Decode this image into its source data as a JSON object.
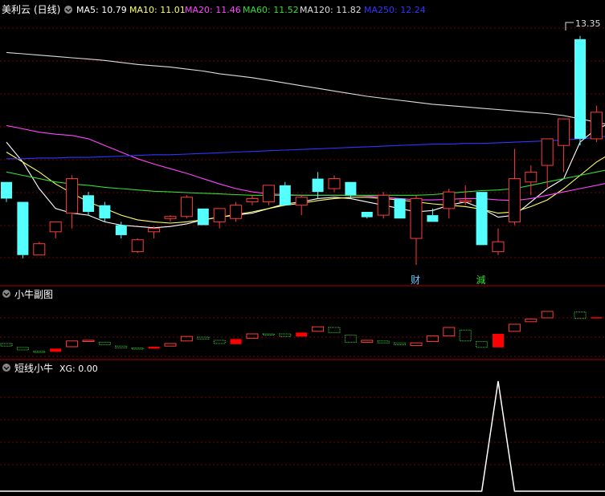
{
  "main_panel": {
    "stock_name": "美利云",
    "period": "(日线)",
    "ma_legend": [
      {
        "label": "MA5: 10.79",
        "color": "#ffffff"
      },
      {
        "label": "MA10: 11.01",
        "color": "#ffff66"
      },
      {
        "label": "MA20: 11.46",
        "color": "#ff44ff"
      },
      {
        "label": "MA60: 11.52",
        "color": "#33dd33"
      },
      {
        "label": "MA120: 11.82",
        "color": "#dddddd"
      },
      {
        "label": "MA250: 12.24",
        "color": "#3333ff"
      }
    ],
    "high_marker": "13.35",
    "markers": [
      {
        "label": "财",
        "index": 25,
        "color": "#66ccff"
      },
      {
        "label": "減",
        "index": 29,
        "color": "#33dd33"
      }
    ]
  },
  "sub_panel_1": {
    "title": "小牛副图"
  },
  "sub_panel_2": {
    "title": "短线小牛",
    "value_label": "XG: 0.00"
  },
  "colors": {
    "up": "#ff3b3b",
    "down": "#54ffff",
    "grid": "#7a0000",
    "divider": "#b00000",
    "indicator_up": "#ff3b3b",
    "indicator_up_fill": "#ff0000",
    "indicator_down": "#33dd33",
    "xg_line": "#ffffff"
  },
  "chart_data": [
    {
      "type": "candlestick",
      "title": "美利云 (日线)",
      "ylim": [
        9.6,
        13.6
      ],
      "candles": [
        {
          "o": 11.15,
          "h": 11.15,
          "l": 10.85,
          "c": 10.9
        },
        {
          "o": 10.85,
          "h": 10.85,
          "l": 10.0,
          "c": 10.05
        },
        {
          "o": 10.05,
          "h": 10.25,
          "l": 10.05,
          "c": 10.22
        },
        {
          "o": 10.4,
          "h": 10.55,
          "l": 10.3,
          "c": 10.55
        },
        {
          "o": 10.68,
          "h": 11.25,
          "l": 10.45,
          "c": 11.2
        },
        {
          "o": 10.95,
          "h": 11.0,
          "l": 10.65,
          "c": 10.7
        },
        {
          "o": 10.8,
          "h": 10.85,
          "l": 10.55,
          "c": 10.6
        },
        {
          "o": 10.5,
          "h": 10.55,
          "l": 10.3,
          "c": 10.35
        },
        {
          "o": 10.1,
          "h": 10.3,
          "l": 10.08,
          "c": 10.28
        },
        {
          "o": 10.4,
          "h": 10.48,
          "l": 10.3,
          "c": 10.45
        },
        {
          "o": 10.6,
          "h": 10.65,
          "l": 10.55,
          "c": 10.63
        },
        {
          "o": 10.63,
          "h": 10.95,
          "l": 10.6,
          "c": 10.92
        },
        {
          "o": 10.75,
          "h": 10.75,
          "l": 10.5,
          "c": 10.5
        },
        {
          "o": 10.55,
          "h": 10.75,
          "l": 10.45,
          "c": 10.75
        },
        {
          "o": 10.6,
          "h": 10.85,
          "l": 10.55,
          "c": 10.8
        },
        {
          "o": 10.85,
          "h": 10.95,
          "l": 10.8,
          "c": 10.9
        },
        {
          "o": 10.85,
          "h": 11.1,
          "l": 10.8,
          "c": 11.1
        },
        {
          "o": 11.1,
          "h": 11.15,
          "l": 10.8,
          "c": 10.8
        },
        {
          "o": 10.8,
          "h": 10.95,
          "l": 10.65,
          "c": 10.92
        },
        {
          "o": 11.2,
          "h": 11.3,
          "l": 10.9,
          "c": 11.0
        },
        {
          "o": 11.05,
          "h": 11.25,
          "l": 11.0,
          "c": 11.2
        },
        {
          "o": 11.15,
          "h": 11.15,
          "l": 10.9,
          "c": 10.95
        },
        {
          "o": 10.7,
          "h": 10.7,
          "l": 10.6,
          "c": 10.62
        },
        {
          "o": 10.65,
          "h": 11.0,
          "l": 10.6,
          "c": 10.95
        },
        {
          "o": 10.9,
          "h": 10.9,
          "l": 10.6,
          "c": 10.6
        },
        {
          "o": 10.3,
          "h": 10.95,
          "l": 9.9,
          "c": 10.9
        },
        {
          "o": 10.65,
          "h": 10.75,
          "l": 10.55,
          "c": 10.55
        },
        {
          "o": 10.75,
          "h": 11.05,
          "l": 10.6,
          "c": 11.0
        },
        {
          "o": 10.85,
          "h": 11.1,
          "l": 10.8,
          "c": 10.87
        },
        {
          "o": 11.0,
          "h": 11.0,
          "l": 10.2,
          "c": 10.2
        },
        {
          "o": 10.1,
          "h": 10.45,
          "l": 10.05,
          "c": 10.25
        },
        {
          "o": 10.55,
          "h": 11.65,
          "l": 10.5,
          "c": 11.2
        },
        {
          "o": 11.15,
          "h": 11.4,
          "l": 10.95,
          "c": 11.3
        },
        {
          "o": 11.4,
          "h": 11.8,
          "l": 11.05,
          "c": 11.8
        },
        {
          "o": 11.7,
          "h": 12.1,
          "l": 11.3,
          "c": 12.1
        },
        {
          "o": 13.3,
          "h": 13.35,
          "l": 11.7,
          "c": 11.8
        },
        {
          "o": 11.8,
          "h": 12.3,
          "l": 11.75,
          "c": 12.2
        },
        {
          "o": 12.0,
          "h": 12.05,
          "l": 11.8,
          "c": 11.92
        }
      ],
      "ma_lines": [
        {
          "name": "MA5",
          "color": "#ffffff",
          "values": [
            11.75,
            11.45,
            11.05,
            10.75,
            10.68,
            10.65,
            10.55,
            10.5,
            10.48,
            10.46,
            10.48,
            10.52,
            10.58,
            10.62,
            10.65,
            10.68,
            10.75,
            10.82,
            10.85,
            10.9,
            10.92,
            10.9,
            10.85,
            10.8,
            10.75,
            10.7,
            10.72,
            10.8,
            10.85,
            10.75,
            10.62,
            10.65,
            10.85,
            11.05,
            11.2,
            11.75,
            11.95,
            12.05
          ]
        },
        {
          "name": "MA10",
          "color": "#ffff66",
          "values": [
            11.6,
            11.45,
            11.3,
            11.12,
            10.98,
            10.85,
            10.75,
            10.65,
            10.58,
            10.55,
            10.53,
            10.55,
            10.58,
            10.62,
            10.66,
            10.7,
            10.75,
            10.8,
            10.83,
            10.87,
            10.9,
            10.92,
            10.92,
            10.9,
            10.88,
            10.85,
            10.82,
            10.8,
            10.78,
            10.74,
            10.68,
            10.7,
            10.78,
            10.88,
            11.05,
            11.25,
            11.45,
            11.6
          ]
        },
        {
          "name": "MA20",
          "color": "#ff44ff",
          "values": [
            12.0,
            11.95,
            11.9,
            11.87,
            11.85,
            11.8,
            11.7,
            11.6,
            11.5,
            11.42,
            11.35,
            11.28,
            11.2,
            11.12,
            11.05,
            11.0,
            10.97,
            10.96,
            10.95,
            10.95,
            10.95,
            10.95,
            10.94,
            10.92,
            10.9,
            10.88,
            10.88,
            10.89,
            10.9,
            10.9,
            10.88,
            10.87,
            10.9,
            10.95,
            11.0,
            11.05,
            11.1,
            11.15
          ]
        },
        {
          "name": "MA60",
          "color": "#33dd33",
          "values": [
            11.3,
            11.25,
            11.2,
            11.15,
            11.12,
            11.1,
            11.07,
            11.05,
            11.03,
            11.01,
            11.0,
            10.99,
            10.98,
            10.97,
            10.96,
            10.95,
            10.95,
            10.95,
            10.95,
            10.95,
            10.95,
            10.95,
            10.95,
            10.95,
            10.95,
            10.95,
            10.96,
            10.98,
            11.0,
            11.02,
            11.03,
            11.05,
            11.1,
            11.15,
            11.2,
            11.25,
            11.3,
            11.35
          ]
        },
        {
          "name": "MA120",
          "color": "#dddddd",
          "values": [
            13.1,
            13.08,
            13.06,
            13.04,
            13.02,
            13.0,
            12.98,
            12.95,
            12.92,
            12.9,
            12.88,
            12.85,
            12.82,
            12.78,
            12.75,
            12.72,
            12.68,
            12.64,
            12.6,
            12.56,
            12.52,
            12.48,
            12.44,
            12.41,
            12.38,
            12.35,
            12.32,
            12.3,
            12.28,
            12.26,
            12.24,
            12.22,
            12.2,
            12.18,
            12.15,
            12.1,
            12.05,
            12.0
          ]
        },
        {
          "name": "MA250",
          "color": "#3333ff",
          "values": [
            11.5,
            11.5,
            11.51,
            11.51,
            11.52,
            11.52,
            11.53,
            11.54,
            11.55,
            11.56,
            11.56,
            11.57,
            11.58,
            11.59,
            11.6,
            11.61,
            11.62,
            11.63,
            11.64,
            11.65,
            11.66,
            11.67,
            11.68,
            11.69,
            11.7,
            11.71,
            11.72,
            11.72,
            11.73,
            11.73,
            11.74,
            11.75,
            11.76,
            11.77,
            11.78,
            11.8,
            11.82,
            11.85
          ]
        }
      ]
    },
    {
      "type": "bar",
      "title": "小牛副图",
      "ylim": [
        0,
        9
      ],
      "bars": [
        {
          "low": 2.1,
          "high": 2.5,
          "dir": "down"
        },
        {
          "low": 1.5,
          "high": 1.9,
          "dir": "down"
        },
        {
          "low": 1.1,
          "high": 1.3,
          "dir": "down"
        },
        {
          "low": 1.2,
          "high": 1.7,
          "dir": "up_fill"
        },
        {
          "low": 2.0,
          "high": 2.9,
          "dir": "up"
        },
        {
          "low": 2.9,
          "high": 3.0,
          "dir": "up"
        },
        {
          "low": 2.3,
          "high": 2.7,
          "dir": "down"
        },
        {
          "low": 1.8,
          "high": 2.1,
          "dir": "down"
        },
        {
          "low": 1.7,
          "high": 1.8,
          "dir": "down"
        },
        {
          "low": 1.7,
          "high": 2.0,
          "dir": "up_fill"
        },
        {
          "low": 2.1,
          "high": 2.5,
          "dir": "up"
        },
        {
          "low": 2.9,
          "high": 3.6,
          "dir": "up"
        },
        {
          "low": 3.2,
          "high": 3.5,
          "dir": "down"
        },
        {
          "low": 2.5,
          "high": 3.0,
          "dir": "down"
        },
        {
          "low": 2.4,
          "high": 3.2,
          "dir": "up_fill"
        },
        {
          "low": 3.3,
          "high": 4.0,
          "dir": "up"
        },
        {
          "low": 3.9,
          "high": 4.0,
          "dir": "down"
        },
        {
          "low": 3.6,
          "high": 4.0,
          "dir": "down"
        },
        {
          "low": 3.6,
          "high": 4.2,
          "dir": "up_fill"
        },
        {
          "low": 4.4,
          "high": 5.1,
          "dir": "up"
        },
        {
          "low": 4.2,
          "high": 5.0,
          "dir": "down"
        },
        {
          "low": 2.7,
          "high": 3.8,
          "dir": "down"
        },
        {
          "low": 2.7,
          "high": 3.0,
          "dir": "up"
        },
        {
          "low": 2.6,
          "high": 2.9,
          "dir": "down"
        },
        {
          "low": 2.3,
          "high": 2.6,
          "dir": "down"
        },
        {
          "low": 2.2,
          "high": 2.6,
          "dir": "up"
        },
        {
          "low": 2.8,
          "high": 3.7,
          "dir": "up"
        },
        {
          "low": 3.7,
          "high": 5.0,
          "dir": "up"
        },
        {
          "low": 2.9,
          "high": 4.6,
          "dir": "down"
        },
        {
          "low": 1.9,
          "high": 2.8,
          "dir": "down"
        },
        {
          "low": 1.9,
          "high": 4.0,
          "dir": "up_fill"
        },
        {
          "low": 4.4,
          "high": 5.5,
          "dir": "up"
        },
        {
          "low": 5.9,
          "high": 6.3,
          "dir": "up"
        },
        {
          "low": 6.5,
          "high": 7.5,
          "dir": "up"
        },
        {
          "low": null,
          "high": null,
          "dir": "none"
        },
        {
          "low": 6.4,
          "high": 7.4,
          "dir": "down"
        },
        {
          "low": 6.5,
          "high": 6.6,
          "dir": "up_fill"
        }
      ]
    },
    {
      "type": "line",
      "title": "短线小牛",
      "ylim": [
        0,
        1.05
      ],
      "series": [
        {
          "values": [
            0,
            0,
            0,
            0,
            0,
            0,
            0,
            0,
            0,
            0,
            0,
            0,
            0,
            0,
            0,
            0,
            0,
            0,
            0,
            0,
            0,
            0,
            0,
            0,
            0,
            0,
            0,
            0,
            0,
            0,
            1,
            0,
            0,
            0,
            0,
            0,
            0,
            0
          ]
        }
      ]
    }
  ]
}
